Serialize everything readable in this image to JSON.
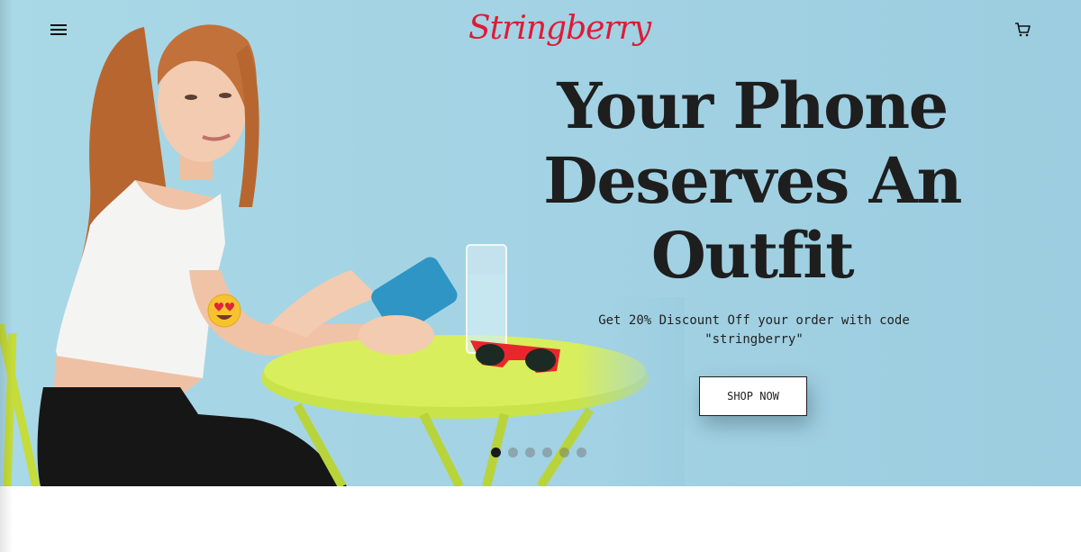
{
  "header": {
    "menu_icon": "hamburger-menu-icon",
    "logo_text": "Stringberry",
    "cart_icon": "shopping-cart-icon"
  },
  "hero": {
    "headline_lines": [
      "Your Phone",
      "Deserves An",
      "Outfit"
    ],
    "subtext_line1": "Get 20% Discount Off your order with code",
    "subtext_line2": "\"stringberry\"",
    "cta_label": "SHOP NOW",
    "carousel": {
      "slide_count": 6,
      "active_index": 0
    },
    "emoji_icon": "heart-eyes-emoji-icon"
  },
  "colors": {
    "hero_background": "#a3d3e4",
    "logo": "#e01a35",
    "headline": "#1e1e1e",
    "table": "#c9e34a",
    "phone_case": "#2f95c4"
  }
}
